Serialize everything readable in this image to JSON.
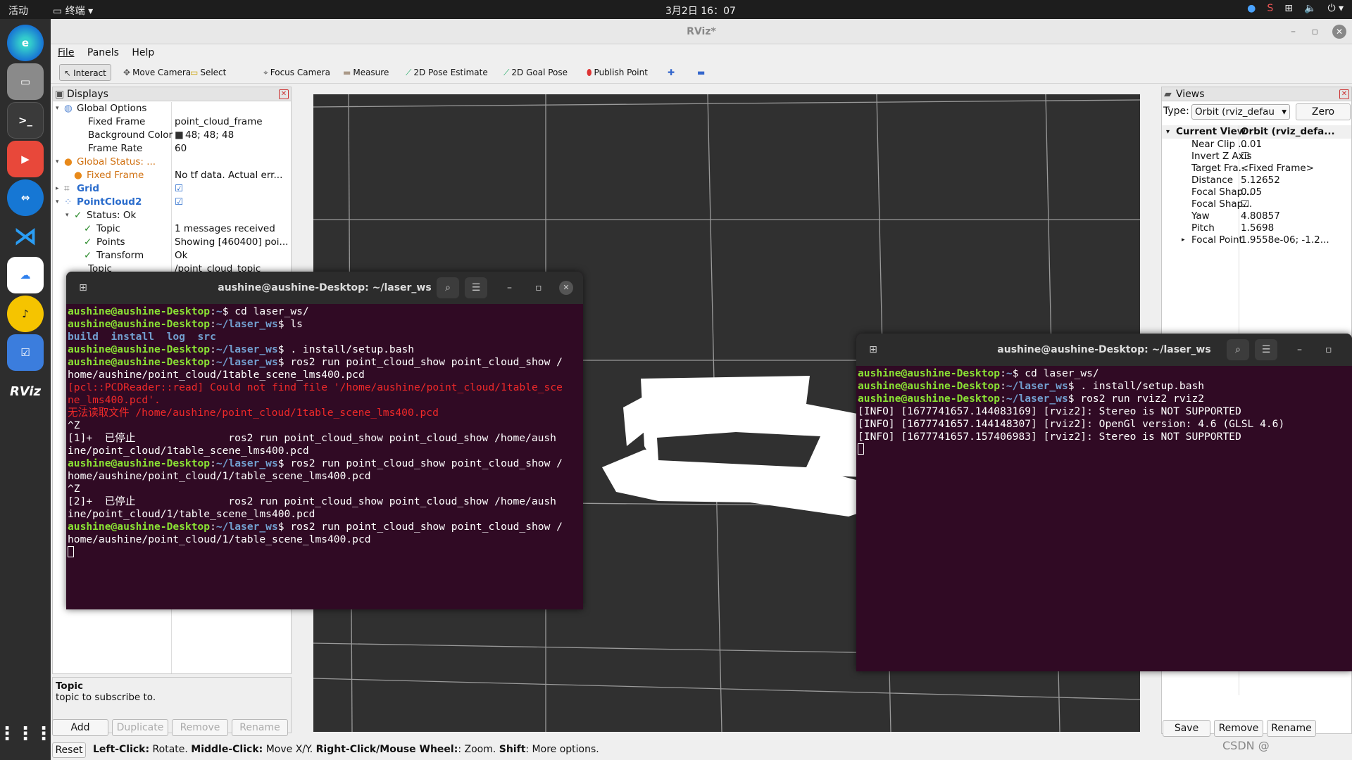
{
  "topbar": {
    "activities": "活动",
    "app": "终端",
    "clock": "3月2日  16：07"
  },
  "window": {
    "title": "RViz*"
  },
  "menu": [
    "File",
    "Panels",
    "Help"
  ],
  "toolbar": [
    {
      "label": "Interact",
      "icon": "pointer-icon"
    },
    {
      "label": "Move Camera",
      "icon": "move-icon"
    },
    {
      "label": "Select",
      "icon": "select-icon"
    },
    {
      "label": "Focus Camera",
      "icon": "focus-icon"
    },
    {
      "label": "Measure",
      "icon": "ruler-icon"
    },
    {
      "label": "2D Pose Estimate",
      "icon": "arrow-icon"
    },
    {
      "label": "2D Goal Pose",
      "icon": "arrow-icon"
    },
    {
      "label": "Publish Point",
      "icon": "pin-icon"
    }
  ],
  "displays": {
    "title": "Displays",
    "rows": [
      {
        "name": "Global Options",
        "value": ""
      },
      {
        "name": "Fixed Frame",
        "value": "point_cloud_frame"
      },
      {
        "name": "Background Color",
        "value": "48; 48; 48"
      },
      {
        "name": "Frame Rate",
        "value": "60"
      },
      {
        "name": "Global Status: ...",
        "value": ""
      },
      {
        "name": "Fixed Frame",
        "value": "No tf data.  Actual err..."
      },
      {
        "name": "Grid",
        "value": ""
      },
      {
        "name": "PointCloud2",
        "value": ""
      },
      {
        "name": "Status: Ok",
        "value": ""
      },
      {
        "name": "Topic",
        "value": "1 messages received"
      },
      {
        "name": "Points",
        "value": "Showing [460400] poi..."
      },
      {
        "name": "Transform",
        "value": "Ok"
      },
      {
        "name": "Topic",
        "value": "/point_cloud_topic"
      }
    ],
    "help_title": "Topic",
    "help_text": "topic to subscribe to.",
    "buttons": [
      "Add",
      "Duplicate",
      "Remove",
      "Rename"
    ]
  },
  "views": {
    "title": "Views",
    "type_label": "Type:",
    "type_value": "Orbit (rviz_defau",
    "zero": "Zero",
    "header": [
      "Current View",
      "Orbit (rviz_defa..."
    ],
    "rows": [
      {
        "name": "Near Clip ...",
        "value": "0.01"
      },
      {
        "name": "Invert Z Axis",
        "value": ""
      },
      {
        "name": "Target Fra...",
        "value": "<Fixed Frame>"
      },
      {
        "name": "Distance",
        "value": "5.12652"
      },
      {
        "name": "Focal Shap...",
        "value": "0.05"
      },
      {
        "name": "Focal Shap...",
        "value": ""
      },
      {
        "name": "Yaw",
        "value": "4.80857"
      },
      {
        "name": "Pitch",
        "value": "1.5698"
      },
      {
        "name": "Focal Point",
        "value": "1.9558e-06; -1.2..."
      }
    ],
    "buttons": [
      "Save",
      "Remove",
      "Rename"
    ]
  },
  "status": {
    "reset": "Reset",
    "text_parts": [
      [
        "Left-Click:",
        " Rotate. "
      ],
      [
        "Middle-Click:",
        " Move X/Y. "
      ],
      [
        "Right-Click/Mouse Wheel:",
        ": Zoom. "
      ],
      [
        "Shift",
        ": More options."
      ]
    ]
  },
  "term1": {
    "title": "aushine@aushine-Desktop: ~/laser_ws",
    "lines": [
      [
        [
          "g",
          "aushine@aushine-Desktop"
        ],
        [
          "w",
          ":"
        ],
        [
          "b",
          "~"
        ],
        [
          "w",
          "$ cd laser_ws/"
        ]
      ],
      [
        [
          "g",
          "aushine@aushine-Desktop"
        ],
        [
          "w",
          ":"
        ],
        [
          "b",
          "~/laser_ws"
        ],
        [
          "w",
          "$ ls"
        ]
      ],
      [
        [
          "b",
          "build  install  log  src"
        ]
      ],
      [
        [
          "g",
          "aushine@aushine-Desktop"
        ],
        [
          "w",
          ":"
        ],
        [
          "b",
          "~/laser_ws"
        ],
        [
          "w",
          "$ . install/setup.bash"
        ]
      ],
      [
        [
          "g",
          "aushine@aushine-Desktop"
        ],
        [
          "w",
          ":"
        ],
        [
          "b",
          "~/laser_ws"
        ],
        [
          "w",
          "$ ros2 run point_cloud_show point_cloud_show /"
        ]
      ],
      [
        [
          "w",
          "home/aushine/point_cloud/1table_scene_lms400.pcd"
        ]
      ],
      [
        [
          "r",
          "[pcl::PCDReader::read] Could not find file '/home/aushine/point_cloud/1table_sce"
        ]
      ],
      [
        [
          "r",
          "ne_lms400.pcd'."
        ]
      ],
      [
        [
          "r",
          "无法读取文件 /home/aushine/point_cloud/1table_scene_lms400.pcd"
        ]
      ],
      [
        [
          "w",
          "^Z"
        ]
      ],
      [
        [
          "w",
          "[1]+  已停止               ros2 run point_cloud_show point_cloud_show /home/aush"
        ]
      ],
      [
        [
          "w",
          "ine/point_cloud/1table_scene_lms400.pcd"
        ]
      ],
      [
        [
          "g",
          "aushine@aushine-Desktop"
        ],
        [
          "w",
          ":"
        ],
        [
          "b",
          "~/laser_ws"
        ],
        [
          "w",
          "$ ros2 run point_cloud_show point_cloud_show /"
        ]
      ],
      [
        [
          "w",
          "home/aushine/point_cloud/1/table_scene_lms400.pcd"
        ]
      ],
      [
        [
          "w",
          "^Z"
        ]
      ],
      [
        [
          "w",
          "[2]+  已停止               ros2 run point_cloud_show point_cloud_show /home/aush"
        ]
      ],
      [
        [
          "w",
          "ine/point_cloud/1/table_scene_lms400.pcd"
        ]
      ],
      [
        [
          "g",
          "aushine@aushine-Desktop"
        ],
        [
          "w",
          ":"
        ],
        [
          "b",
          "~/laser_ws"
        ],
        [
          "w",
          "$ ros2 run point_cloud_show point_cloud_show /"
        ]
      ],
      [
        [
          "w",
          "home/aushine/point_cloud/1/table_scene_lms400.pcd"
        ]
      ]
    ]
  },
  "term2": {
    "title": "aushine@aushine-Desktop: ~/laser_ws",
    "lines": [
      [
        [
          "g",
          "aushine@aushine-Desktop"
        ],
        [
          "w",
          ":"
        ],
        [
          "b",
          "~"
        ],
        [
          "w",
          "$ cd laser_ws/"
        ]
      ],
      [
        [
          "g",
          "aushine@aushine-Desktop"
        ],
        [
          "w",
          ":"
        ],
        [
          "b",
          "~/laser_ws"
        ],
        [
          "w",
          "$ . install/setup.bash"
        ]
      ],
      [
        [
          "g",
          "aushine@aushine-Desktop"
        ],
        [
          "w",
          ":"
        ],
        [
          "b",
          "~/laser_ws"
        ],
        [
          "w",
          "$ ros2 run rviz2 rviz2"
        ]
      ],
      [
        [
          "w",
          "[INFO] [1677741657.144083169] [rviz2]: Stereo is NOT SUPPORTED"
        ]
      ],
      [
        [
          "w",
          "[INFO] [1677741657.144148307] [rviz2]: OpenGl version: 4.6 (GLSL 4.6)"
        ]
      ],
      [
        [
          "w",
          "[INFO] [1677741657.157406983] [rviz2]: Stereo is NOT SUPPORTED"
        ]
      ]
    ]
  },
  "watermark": "CSDN @"
}
